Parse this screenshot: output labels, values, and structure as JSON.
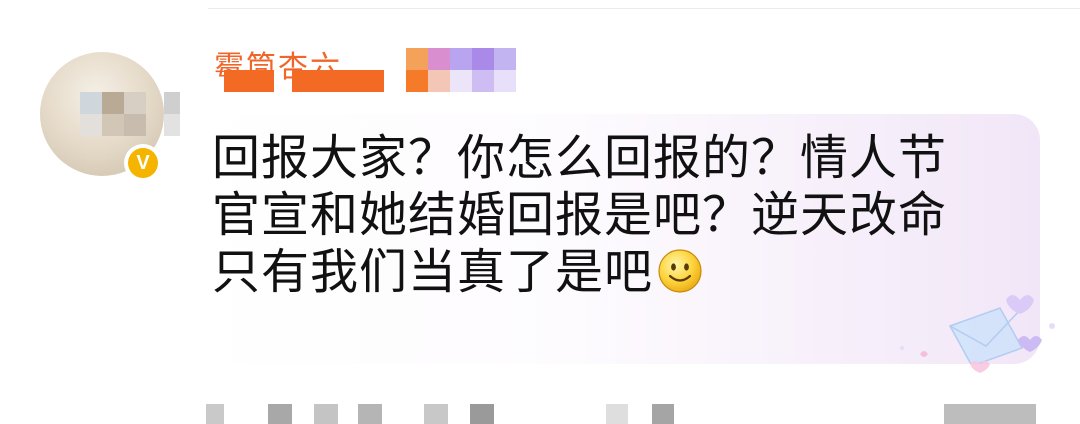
{
  "comment": {
    "username": "霉筒杏六",
    "lines": [
      "回报大家？你怎么回报的？情人节",
      "官宣和她结婚回报是吧？逆天改命",
      "只有我们当真了是吧"
    ],
    "emoji": "smile-emoji"
  },
  "avatar": {
    "badge_label": "V"
  },
  "colors": {
    "username": "#f0662a",
    "badge": "#f5b400",
    "bubble_tint": "#f1e6f7",
    "text": "#111111"
  }
}
